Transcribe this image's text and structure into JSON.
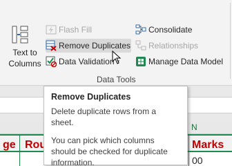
{
  "ribbon": {
    "text_to_columns_label": "Text to Columns",
    "flash_fill_label": "Flash Fill",
    "remove_duplicates_label": "Remove Duplicates",
    "data_validation_label": "Data Validation",
    "consolidate_label": "Consolidate",
    "relationships_label": "Relationships",
    "manage_data_model_label": "Manage Data Model",
    "group_label": "Data Tools"
  },
  "sheet": {
    "column_letter": "N",
    "head_cells": [
      "ge",
      "Rou",
      "Marks"
    ],
    "value_cell": "00"
  },
  "tooltip": {
    "title": "Remove Duplicates",
    "line1": "Delete duplicate rows from a sheet.",
    "line2": "You can pick which columns",
    "line3": "should be checked for duplicate",
    "line4": "information."
  },
  "colors": {
    "accent_green": "#1e8a52",
    "header_red": "#c00000"
  }
}
